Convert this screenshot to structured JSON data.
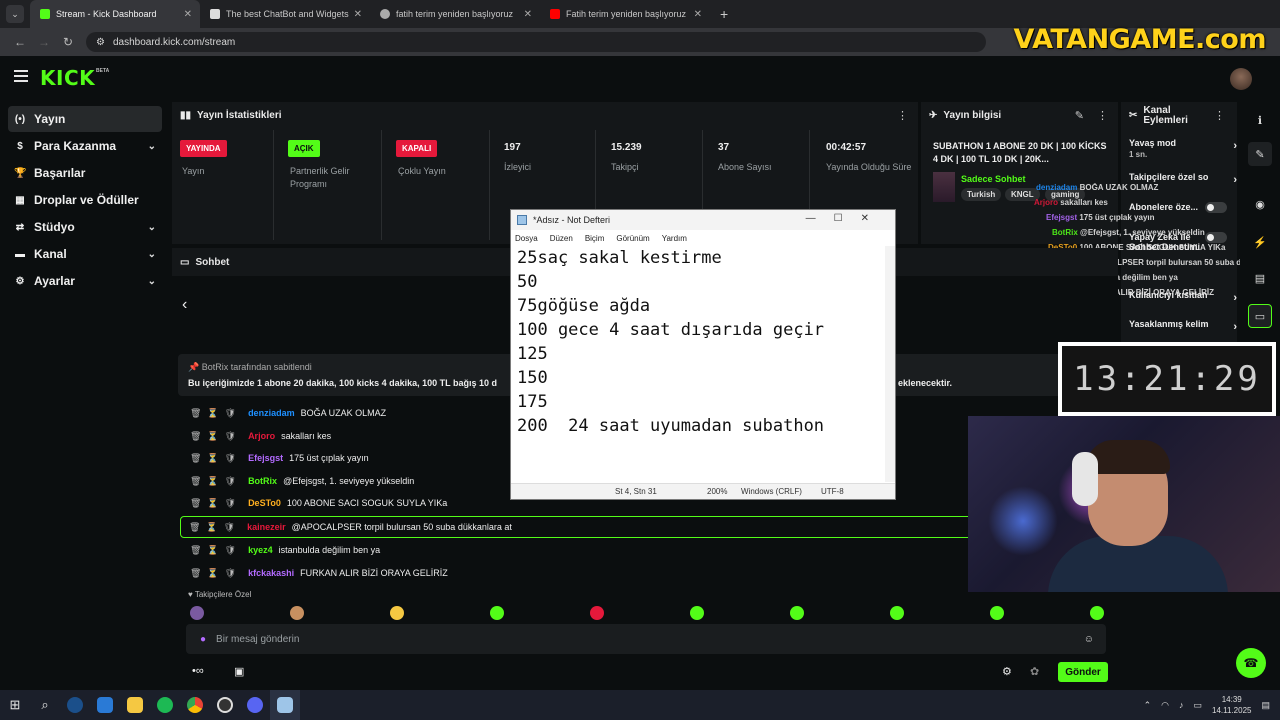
{
  "browser": {
    "tabs": [
      {
        "title": "Stream - Kick Dashboard",
        "color": "#53fc18"
      },
      {
        "title": "The best ChatBot and Widgets",
        "color": "#dddddd"
      },
      {
        "title": "fatih terim yeniden başlıyoruz",
        "color": "#aaaaaa"
      },
      {
        "title": "Fatih terim yeniden başlıyoruz",
        "color": "#ff0000"
      }
    ],
    "new_tab": "+",
    "url": "dashboard.kick.com/stream"
  },
  "watermark": "VATANGAME.com",
  "kick": {
    "logo": "KICK",
    "beta": "BETA"
  },
  "sidebar": {
    "items": [
      {
        "label": "Yayın",
        "icon": "(•)",
        "chevron": ""
      },
      {
        "label": "Para Kazanma",
        "icon": "$",
        "chevron": "⌄"
      },
      {
        "label": "Başarılar",
        "icon": "🏆",
        "chevron": ""
      },
      {
        "label": "Droplar ve Ödüller",
        "icon": "▦",
        "chevron": ""
      },
      {
        "label": "Stüdyo",
        "icon": "⇄",
        "chevron": "⌄"
      },
      {
        "label": "Kanal",
        "icon": "▬",
        "chevron": "⌄"
      },
      {
        "label": "Ayarlar",
        "icon": "⚙",
        "chevron": "⌄"
      }
    ]
  },
  "stats": {
    "title": "Yayın İstatistikleri",
    "items": [
      {
        "badge": "YAYINDA",
        "badge_color": "#e5193b",
        "value": "",
        "label": "Yayın"
      },
      {
        "badge": "AÇIK",
        "badge_color": "#53fc18",
        "value": "",
        "label": "Partnerlik Gelir Programı"
      },
      {
        "badge": "KAPALI",
        "badge_color": "#e5193b",
        "value": "",
        "label": "Çoklu Yayın"
      },
      {
        "badge": "",
        "value": "197",
        "label": "İzleyici"
      },
      {
        "badge": "",
        "value": "15.239",
        "label": "Takipçi"
      },
      {
        "badge": "",
        "value": "37",
        "label": "Abone Sayısı"
      },
      {
        "badge": "",
        "value": "00:42:57",
        "label": "Yayında Olduğu Süre"
      }
    ]
  },
  "info": {
    "title": "Yayın bilgisi",
    "stream_title": "SUBATHON 1 ABONE 20 DK | 100 KİCKS 4 DK | 100 TL 10 DK | 20K...",
    "category": "Sadece Sohbet",
    "tags": [
      "Turkish",
      "KNGL",
      "gaming"
    ]
  },
  "actions": {
    "title": "Kanal Eylemleri",
    "items": [
      {
        "label": "Yavaş mod",
        "sub": "1 sn.",
        "control": "arrow"
      },
      {
        "label": "Takipçilere özel so",
        "sub": "",
        "control": "arrow"
      },
      {
        "label": "Abonelere öze...",
        "sub": "",
        "control": "toggle"
      },
      {
        "label": "Yapay Zeka ile Sohbet Denetimi",
        "sub": "",
        "control": "toggle"
      },
      {
        "label": "Kullanıcıyı kısıtlan",
        "sub": "",
        "control": "arrow"
      },
      {
        "label": "Yasaklanmış kelim",
        "sub": "",
        "control": "arrow"
      }
    ],
    "overlay_chat": [
      {
        "user": "denziadam",
        "text": "BOĞA UZAK OLMAZ"
      },
      {
        "user": "Arjoro",
        "text": "sakalları kes"
      },
      {
        "user": "Efejsgst",
        "text": "175 üst çıplak yayın"
      },
      {
        "user": "BotRix",
        "text": "@Efejsgst, 1. seviyeye yükseldin"
      },
      {
        "user": "DeSTo0",
        "text": "100 ABONE SACI SOGUK SUYLA YIKa"
      },
      {
        "user": "kainezeir",
        "text": "@APOCALPSER torpil bulursan 50 suba dükkanlara at"
      },
      {
        "user": "kyez4",
        "text": "istanbulda değilim ben ya"
      },
      {
        "user": "kfckakashi",
        "text": "FURKAN ALIR BİZİ ORAYA GELİRİZ"
      }
    ]
  },
  "chat": {
    "title": "Sohbet",
    "pinned_by": "BotRix tarafından sabitlendi",
    "pinned_text": "Bu içeriğimizde 1 abone 20 dakika, 100 kicks 4 dakika, 100 TL bağış 10 d",
    "pinned_tail": "eklenecektir.",
    "messages": [
      {
        "user": "denziadam",
        "color": "#1e90ff",
        "text": "BOĞA UZAK OLMAZ",
        "highlight": false
      },
      {
        "user": "Arjoro",
        "color": "#e5193b",
        "text": "sakalları kes",
        "highlight": false
      },
      {
        "user": "Efejsgst",
        "color": "#b36bff",
        "text": "175 üst çıplak yayın",
        "highlight": false
      },
      {
        "user": "BotRix",
        "color": "#53fc18",
        "text": "@Efejsgst, 1. seviyeye yükseldin",
        "highlight": false
      },
      {
        "user": "DeSTo0",
        "color": "#ffb020",
        "text": "100 ABONE SACI SOGUK SUYLA YIKa",
        "highlight": false
      },
      {
        "user": "kainezeir",
        "color": "#e5193b",
        "text": "@APOCALPSER torpil bulursan 50 suba dükkanlara at",
        "highlight": true
      },
      {
        "user": "kyez4",
        "color": "#53fc18",
        "text": "istanbulda değilim ben ya",
        "highlight": false
      },
      {
        "user": "kfckakashi",
        "color": "#b36bff",
        "text": "FURKAN ALIR BİZİ ORAYA GELİRİZ",
        "highlight": false
      }
    ],
    "followers_only": "Takipçilere Özel",
    "input_placeholder": "Bir mesaj gönderin",
    "send_label": "Gönder"
  },
  "notepad": {
    "title": "*Adsız - Not Defteri",
    "menu": [
      "Dosya",
      "Düzen",
      "Biçim",
      "Görünüm",
      "Yardım"
    ],
    "content": "25saç sakal kestirme\n50\n75göğüse ağda\n100 gece 4 saat dışarıda geçir\n125\n150\n175\n200  24 saat uyumadan subathon",
    "status_pos": "St 4, Stn 31",
    "status_zoom": "200%",
    "status_eol": "Windows (CRLF)",
    "status_enc": "UTF-8"
  },
  "overlay_clock": "13:21:29",
  "taskbar": {
    "time": "14:39",
    "date": "14.11.2025"
  }
}
